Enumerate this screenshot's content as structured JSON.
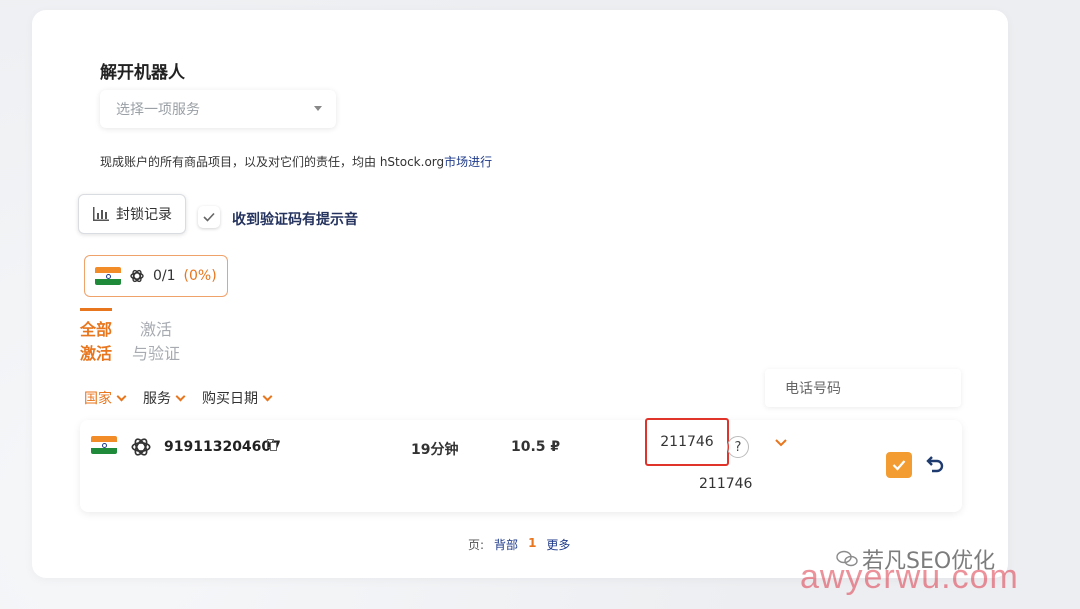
{
  "header": {
    "title": "解开机器人"
  },
  "service_select": {
    "placeholder": "选择一项服务"
  },
  "notice": {
    "text": "现成账户的所有商品项目，以及对它们的责任，均由 hStock.org",
    "link": "市场进行"
  },
  "actions": {
    "history_label": "封锁记录",
    "sound_label": "收到验证码有提示音"
  },
  "stats": {
    "ratio": "0/1",
    "percent": "(0%)"
  },
  "tabs": [
    {
      "label": "全部激活",
      "line1": "全部",
      "line2": "激活"
    },
    {
      "label": "激活与验证",
      "line1": "激活",
      "line2": "与验证"
    }
  ],
  "filters": [
    {
      "label": "国家"
    },
    {
      "label": "服务"
    },
    {
      "label": "购买日期"
    }
  ],
  "phone_search": {
    "placeholder": "电话号码"
  },
  "orders": [
    {
      "country": "india-flag",
      "service": "openai-icon",
      "phone": "919113204607",
      "time": "19分钟",
      "price": "10.5 ₽",
      "code": "211746",
      "code_history": "211746",
      "help": "?"
    }
  ],
  "pagination": {
    "label": "页:",
    "back": "背部",
    "current": "1",
    "more": "更多"
  },
  "watermark": {
    "line1": "若凡SEO优化",
    "line2": "awyerwu.com"
  },
  "colors": {
    "accent": "#e8761e",
    "highlight_border": "#e0342b",
    "link": "#1e3a8a"
  }
}
